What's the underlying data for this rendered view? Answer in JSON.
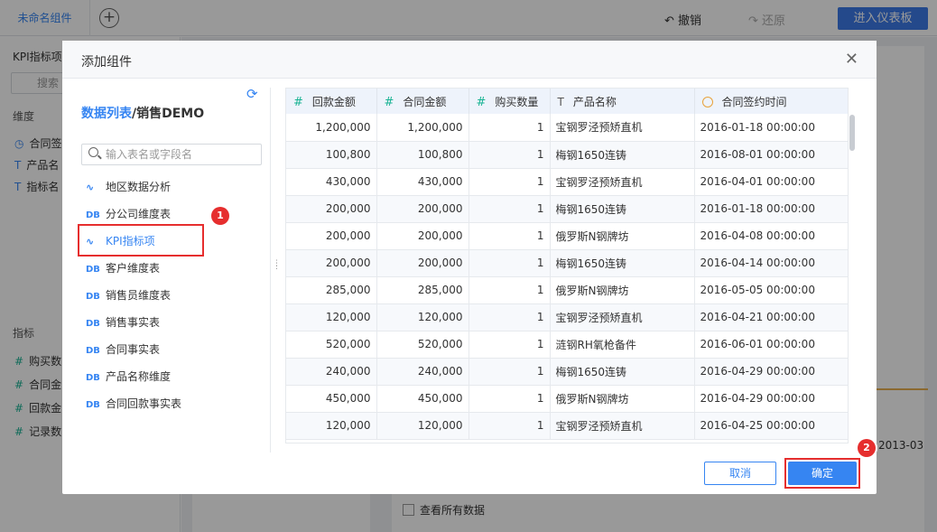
{
  "topbar": {
    "tab_label": "未命名组件",
    "undo_label": "撤销",
    "redo_label": "还原",
    "enter_dashboard_label": "进入仪表板"
  },
  "left_panel": {
    "title": "KPI指标项",
    "search_placeholder": "搜索",
    "dimension_label": "维度",
    "dimensions": [
      "合同签",
      "产品名",
      "指标名"
    ],
    "metric_label": "指标",
    "metrics": [
      "购买数",
      "合同金",
      "回款金",
      "记录数"
    ]
  },
  "background": {
    "view_all_label": "查看所有数据",
    "date_fragment": "2013-03"
  },
  "modal": {
    "title": "添加组件",
    "datasource_link": "数据列表",
    "datasource_sep": "/",
    "datasource_name": "销售DEMO",
    "search_placeholder": "输入表名或字段名",
    "tables": [
      {
        "icon": "analysis",
        "label": "地区数据分析"
      },
      {
        "icon": "DB",
        "label": "分公司维度表"
      },
      {
        "icon": "analysis",
        "label": "KPI指标项",
        "selected": true
      },
      {
        "icon": "DB",
        "label": "客户维度表"
      },
      {
        "icon": "DB",
        "label": "销售员维度表"
      },
      {
        "icon": "DB",
        "label": "销售事实表"
      },
      {
        "icon": "DB",
        "label": "合同事实表"
      },
      {
        "icon": "DB",
        "label": "产品名称维度"
      },
      {
        "icon": "DB",
        "label": "合同回款事实表"
      }
    ],
    "columns": [
      {
        "type": "#",
        "label": "回款金额"
      },
      {
        "type": "#",
        "label": "合同金额"
      },
      {
        "type": "#",
        "label": "购买数量"
      },
      {
        "type": "T",
        "label": "产品名称"
      },
      {
        "type": "clock",
        "label": "合同签约时间"
      }
    ],
    "rows": [
      [
        "1,200,000",
        "1,200,000",
        "1",
        "宝钢罗泾预矫直机",
        "2016-01-18 00:00:00"
      ],
      [
        "100,800",
        "100,800",
        "1",
        "梅钢1650连铸",
        "2016-08-01 00:00:00"
      ],
      [
        "430,000",
        "430,000",
        "1",
        "宝钢罗泾预矫直机",
        "2016-04-01 00:00:00"
      ],
      [
        "200,000",
        "200,000",
        "1",
        "梅钢1650连铸",
        "2016-01-18 00:00:00"
      ],
      [
        "200,000",
        "200,000",
        "1",
        "俄罗斯N钢牌坊",
        "2016-04-08 00:00:00"
      ],
      [
        "200,000",
        "200,000",
        "1",
        "梅钢1650连铸",
        "2016-04-14 00:00:00"
      ],
      [
        "285,000",
        "285,000",
        "1",
        "俄罗斯N钢牌坊",
        "2016-05-05 00:00:00"
      ],
      [
        "120,000",
        "120,000",
        "1",
        "宝钢罗泾预矫直机",
        "2016-04-21 00:00:00"
      ],
      [
        "520,000",
        "520,000",
        "1",
        "涟钢RH氧枪备件",
        "2016-06-01 00:00:00"
      ],
      [
        "240,000",
        "240,000",
        "1",
        "梅钢1650连铸",
        "2016-04-29 00:00:00"
      ],
      [
        "450,000",
        "450,000",
        "1",
        "俄罗斯N钢牌坊",
        "2016-04-29 00:00:00"
      ],
      [
        "120,000",
        "120,000",
        "1",
        "宝钢罗泾预矫直机",
        "2016-04-25 00:00:00"
      ]
    ],
    "cancel_label": "取消",
    "ok_label": "确定",
    "step_badges": [
      "1",
      "2"
    ]
  }
}
